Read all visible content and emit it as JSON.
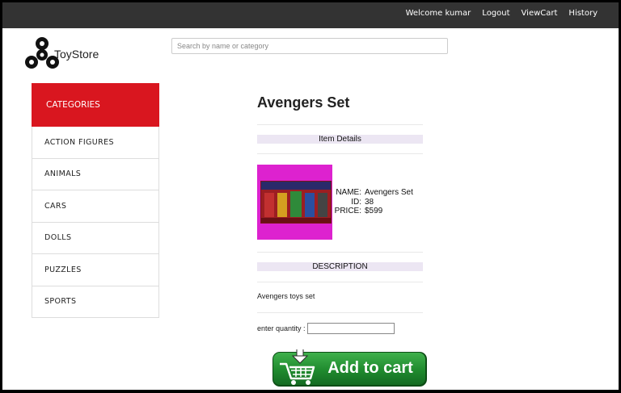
{
  "nav": {
    "welcome": "Welcome kumar",
    "logout": "Logout",
    "view_cart": "ViewCart",
    "history": "History"
  },
  "brand": {
    "name": "ToyStore"
  },
  "search": {
    "placeholder": "Search by name or category",
    "value": ""
  },
  "categories": {
    "title": "CATEGORIES",
    "items": [
      "ACTION FIGURES",
      "ANIMALS",
      "CARS",
      "DOLLS",
      "PUZZLES",
      "SPORTS"
    ]
  },
  "product": {
    "title": "Avengers Set",
    "details_header": "Item Details",
    "name_label": "NAME:",
    "name": "Avengers Set",
    "id_label": "ID:",
    "id": "38",
    "price_label": "PRICE:",
    "price": "$599",
    "description_header": "DESCRIPTION",
    "description": "Avengers toys set",
    "quantity_label": "enter quantity :",
    "quantity_value": ""
  },
  "add_to_cart": {
    "label": "Add to cart"
  },
  "colors": {
    "topbar": "#333333",
    "category_header": "#d9161f",
    "band": "#ece6f3",
    "cart_green": "#1f8a2e"
  }
}
